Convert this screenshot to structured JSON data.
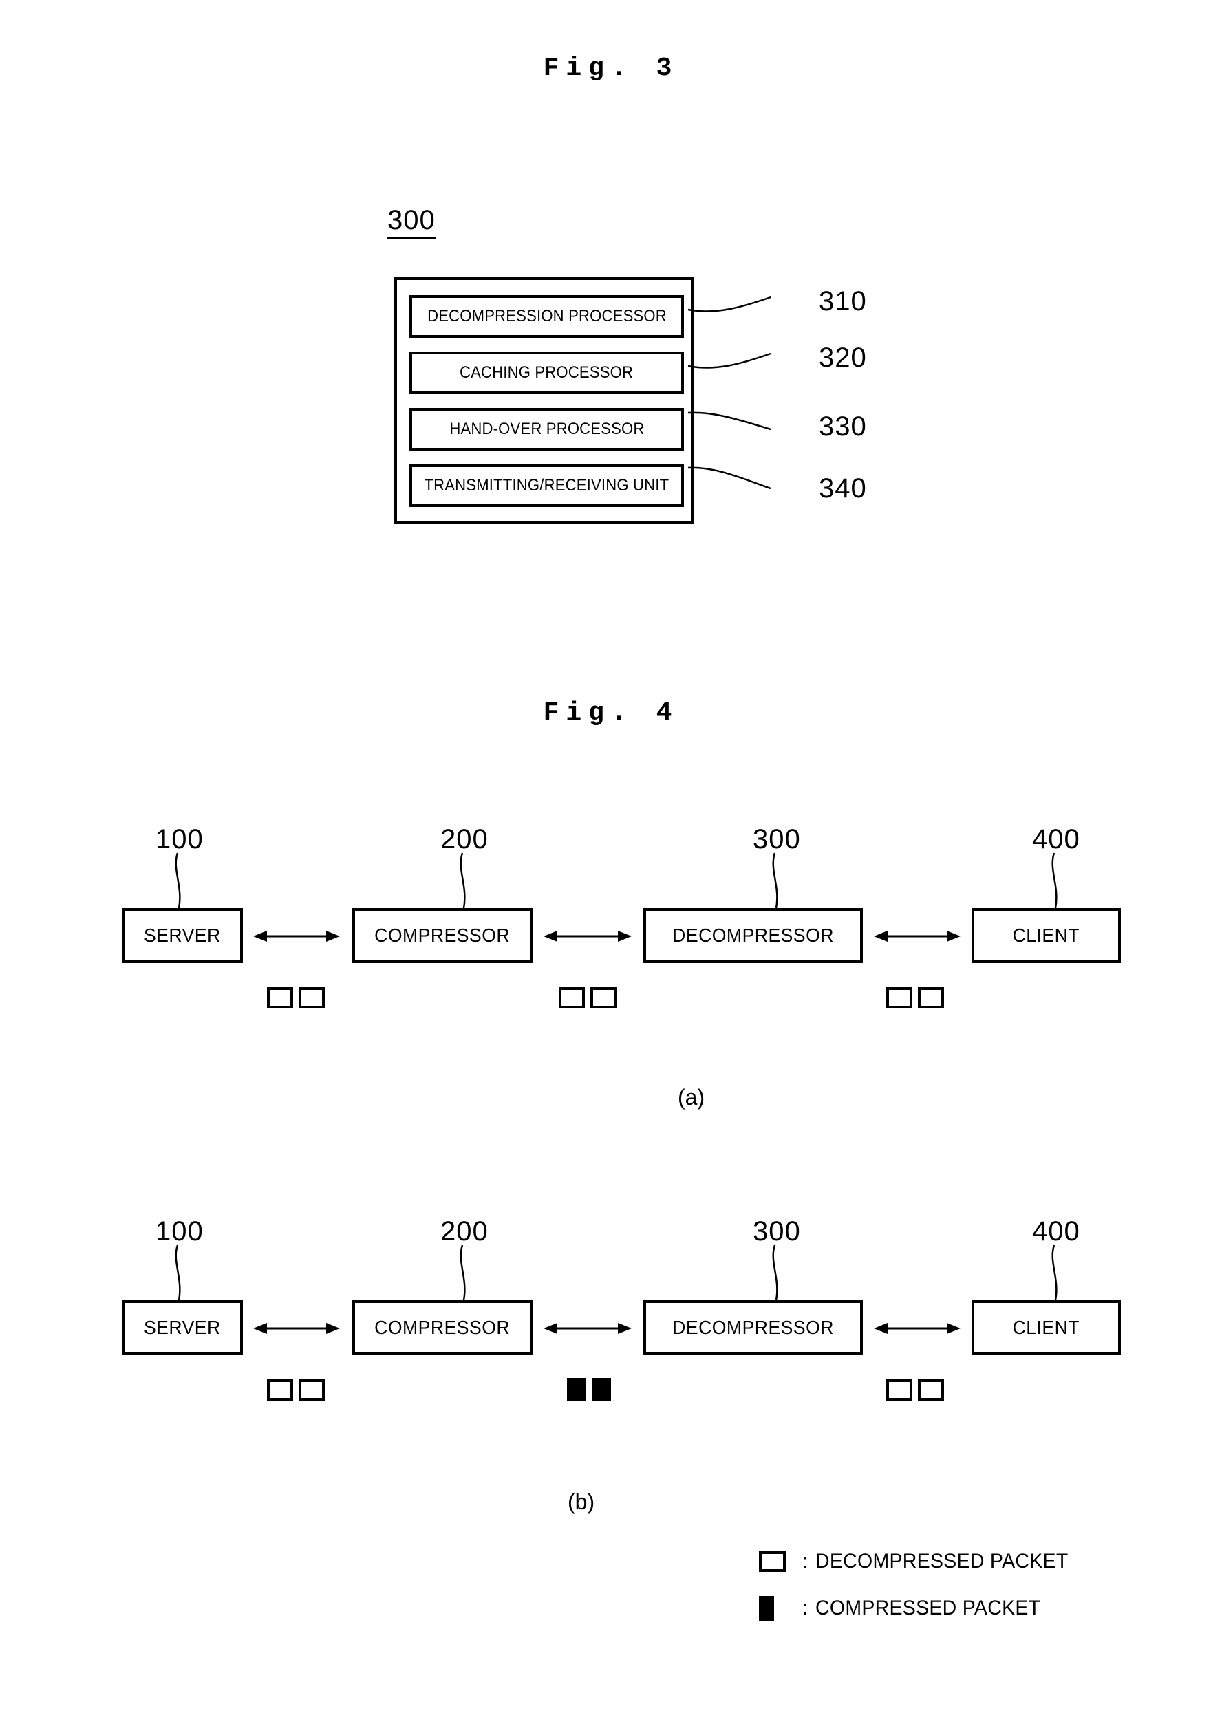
{
  "figures": [
    {
      "title": "Fig.  3",
      "main_ref": "300",
      "blocks": [
        {
          "label": "DECOMPRESSION PROCESSOR",
          "ref": "310"
        },
        {
          "label": "CACHING PROCESSOR",
          "ref": "320"
        },
        {
          "label": "HAND-OVER PROCESSOR",
          "ref": "330"
        },
        {
          "label": "TRANSMITTING/RECEIVING UNIT",
          "ref": "340"
        }
      ]
    },
    {
      "title": "Fig.  4",
      "subfigures": [
        {
          "label": "(a)",
          "nodes": [
            {
              "label": "SERVER",
              "ref": "100"
            },
            {
              "label": "COMPRESSOR",
              "ref": "200"
            },
            {
              "label": "DECOMPRESSOR",
              "ref": "300"
            },
            {
              "label": "CLIENT",
              "ref": "400"
            }
          ],
          "links": [
            {
              "packet_state": "decompressed"
            },
            {
              "packet_state": "decompressed"
            },
            {
              "packet_state": "decompressed"
            }
          ]
        },
        {
          "label": "(b)",
          "nodes": [
            {
              "label": "SERVER",
              "ref": "100"
            },
            {
              "label": "COMPRESSOR",
              "ref": "200"
            },
            {
              "label": "DECOMPRESSOR",
              "ref": "300"
            },
            {
              "label": "CLIENT",
              "ref": "400"
            }
          ],
          "links": [
            {
              "packet_state": "decompressed"
            },
            {
              "packet_state": "compressed"
            },
            {
              "packet_state": "decompressed"
            }
          ]
        }
      ],
      "legend": [
        {
          "swatch": "outlined-square",
          "colon": ":",
          "text": "DECOMPRESSED PACKET"
        },
        {
          "swatch": "filled-square",
          "colon": ":",
          "text": "COMPRESSED PACKET"
        }
      ]
    }
  ],
  "colors": {
    "ink": "#000000",
    "paper": "#ffffff"
  }
}
